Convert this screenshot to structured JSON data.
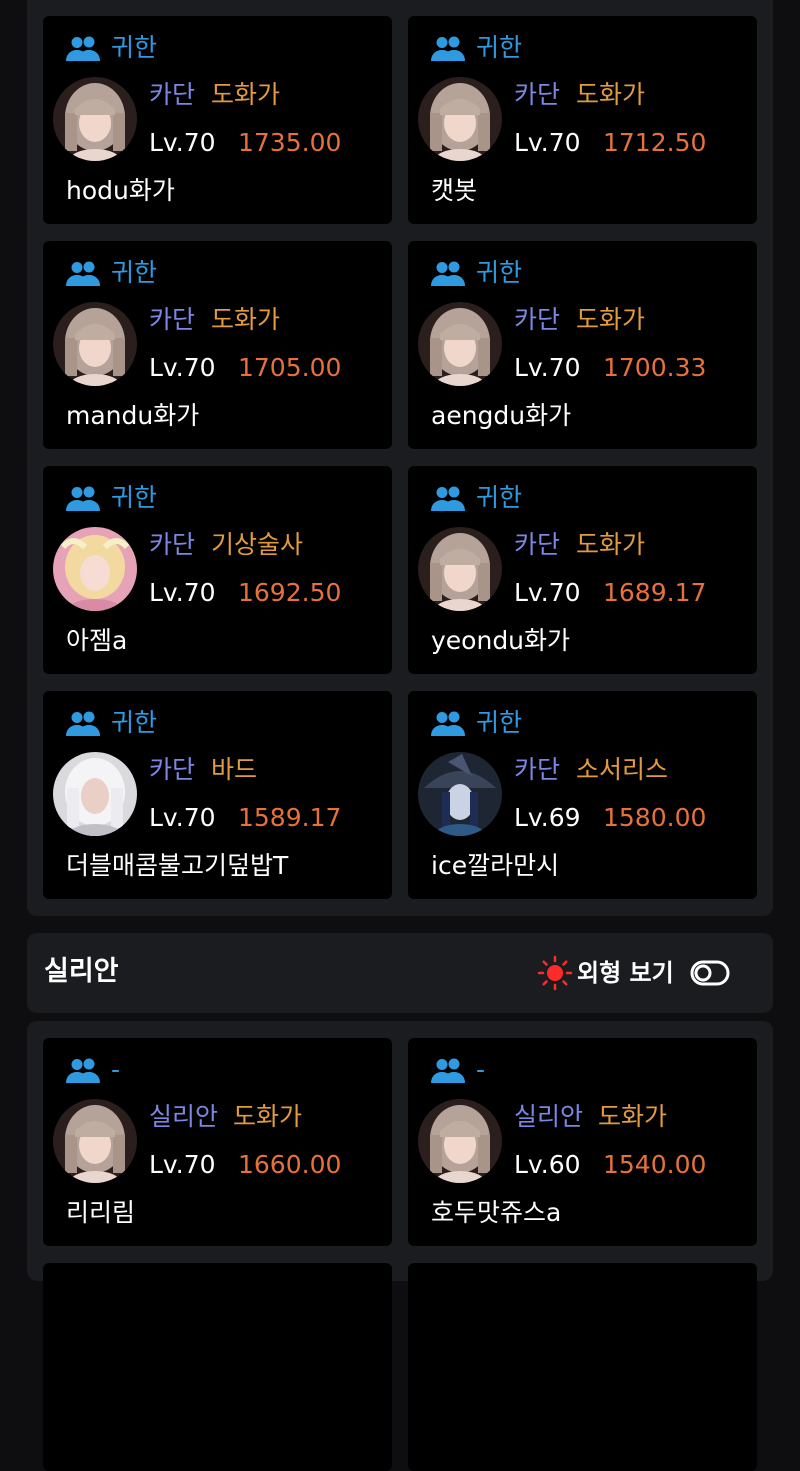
{
  "section1": {
    "cards": [
      {
        "guild": "귀한",
        "server": "카단",
        "class": "도화가",
        "level": "Lv.70",
        "item_level": "1735.00",
        "name": "hodu화가",
        "avatar": "artist-portrait"
      },
      {
        "guild": "귀한",
        "server": "카단",
        "class": "도화가",
        "level": "Lv.70",
        "item_level": "1712.50",
        "name": "캣봇",
        "avatar": "artist-portrait"
      },
      {
        "guild": "귀한",
        "server": "카단",
        "class": "도화가",
        "level": "Lv.70",
        "item_level": "1705.00",
        "name": "mandu화가",
        "avatar": "artist-portrait"
      },
      {
        "guild": "귀한",
        "server": "카단",
        "class": "도화가",
        "level": "Lv.70",
        "item_level": "1700.33",
        "name": "aengdu화가",
        "avatar": "artist-portrait"
      },
      {
        "guild": "귀한",
        "server": "카단",
        "class": "기상술사",
        "level": "Lv.70",
        "item_level": "1692.50",
        "name": "아젬a",
        "avatar": "aeromancer-portrait"
      },
      {
        "guild": "귀한",
        "server": "카단",
        "class": "도화가",
        "level": "Lv.70",
        "item_level": "1689.17",
        "name": "yeondu화가",
        "avatar": "artist-portrait"
      },
      {
        "guild": "귀한",
        "server": "카단",
        "class": "바드",
        "level": "Lv.70",
        "item_level": "1589.17",
        "name": "더블매콤불고기덮밥T",
        "avatar": "bard-portrait"
      },
      {
        "guild": "귀한",
        "server": "카단",
        "class": "소서리스",
        "level": "Lv.69",
        "item_level": "1580.00",
        "name": "ice깔라만시",
        "avatar": "sorceress-portrait"
      }
    ]
  },
  "section2": {
    "title": "실리안",
    "appearance_label": "외형 보기",
    "cards": [
      {
        "guild": "-",
        "server": "실리안",
        "class": "도화가",
        "level": "Lv.70",
        "item_level": "1660.00",
        "name": "리리림",
        "avatar": "artist-portrait"
      },
      {
        "guild": "-",
        "server": "실리안",
        "class": "도화가",
        "level": "Lv.60",
        "item_level": "1540.00",
        "name": "호두맛쥬스a",
        "avatar": "artist-portrait"
      }
    ]
  },
  "colors": {
    "page_bg": "#0e0e10",
    "panel_bg": "#1b1c1f",
    "card_bg": "#000000",
    "guild": "#2f9ae0",
    "server": "#7d86e2",
    "class": "#e39c3d",
    "item_level": "#e6713a",
    "sun": "#ff2a2a"
  },
  "icons": {
    "guild": "users-icon",
    "appearance": "sun-icon",
    "toggle": "toggle-icon"
  }
}
